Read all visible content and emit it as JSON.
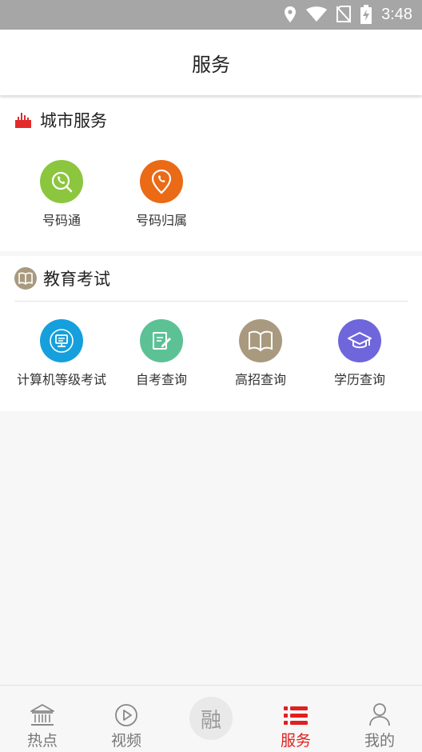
{
  "status_bar": {
    "time": "3:48",
    "icons": [
      "location-icon",
      "wifi-icon",
      "no-sim-icon",
      "battery-charging-icon"
    ]
  },
  "header": {
    "title": "服务"
  },
  "sections": [
    {
      "title": "城市服务",
      "icon": "city-skyline-icon",
      "items": [
        {
          "label": "号码通",
          "icon": "phone-search-icon",
          "color": "#8cc63e"
        },
        {
          "label": "号码归属",
          "icon": "phone-location-icon",
          "color": "#ea6a16"
        }
      ]
    },
    {
      "title": "教育考试",
      "icon": "book-icon",
      "items": [
        {
          "label": "计算机等级考试",
          "icon": "computer-icon",
          "color": "#169fdd"
        },
        {
          "label": "自考查询",
          "icon": "edit-note-icon",
          "color": "#5cc295"
        },
        {
          "label": "高招查询",
          "icon": "open-book-icon",
          "color": "#a99a7f"
        },
        {
          "label": "学历查询",
          "icon": "graduation-cap-icon",
          "color": "#6f66dc"
        }
      ]
    }
  ],
  "tab_bar": {
    "active_color": "#e02020",
    "tabs": [
      {
        "label": "热点",
        "icon": "hotspot-building-icon"
      },
      {
        "label": "视频",
        "icon": "play-circle-icon"
      },
      {
        "label": "融",
        "icon": "rong-center-button"
      },
      {
        "label": "服务",
        "icon": "list-icon",
        "active": true
      },
      {
        "label": "我的",
        "icon": "user-icon"
      }
    ]
  }
}
